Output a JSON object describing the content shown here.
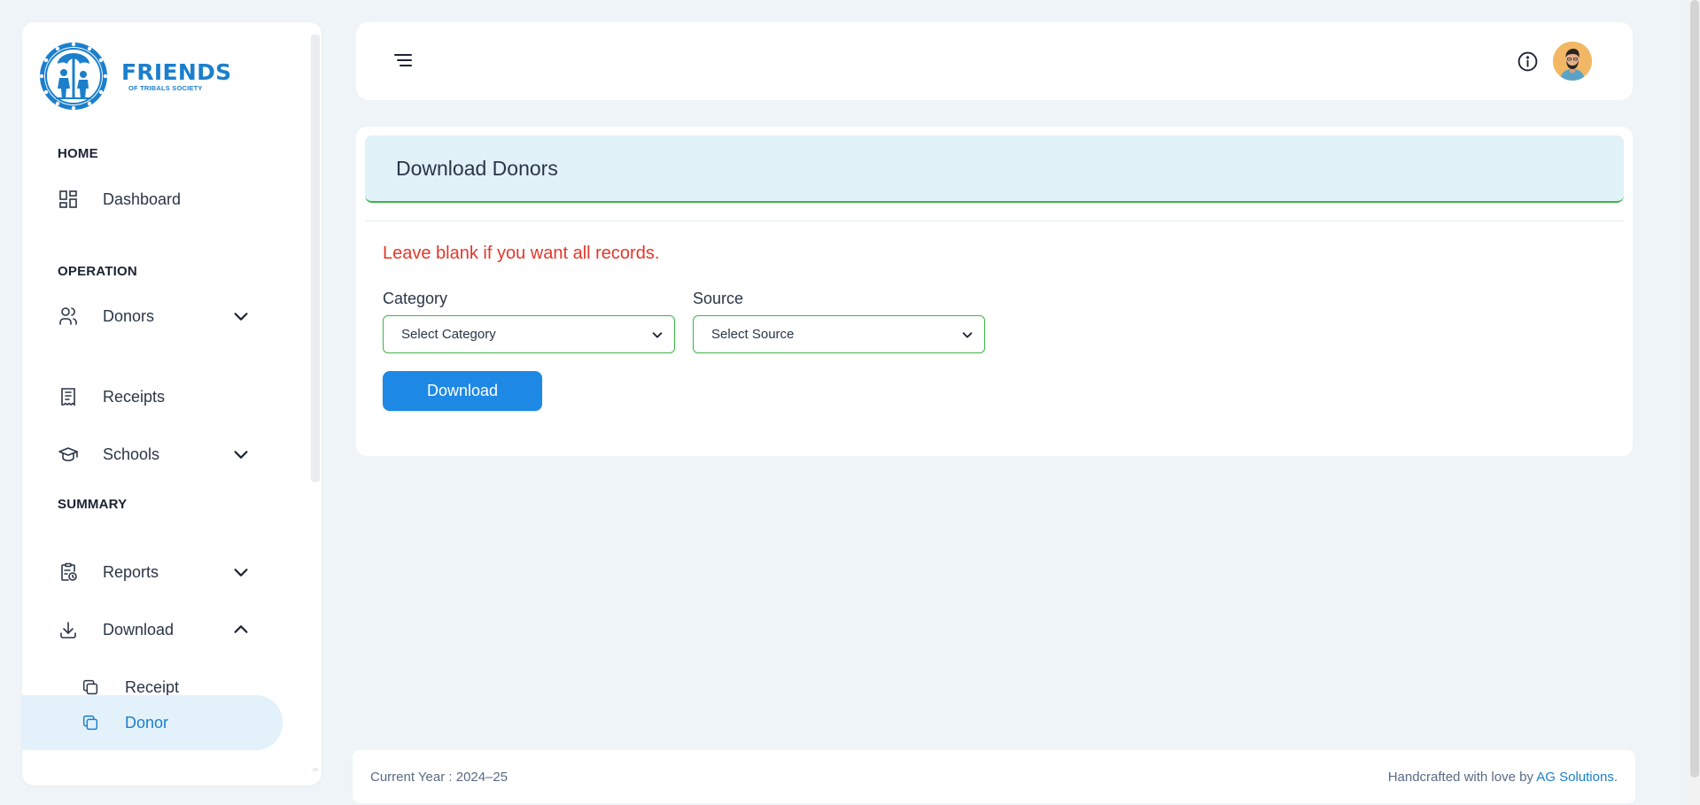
{
  "brand": {
    "name_line1": "FRIENDS",
    "name_line2": "OF TRIBALS SOCIETY",
    "color": "#1b7fcc"
  },
  "sidebar": {
    "sections": [
      {
        "title": "HOME"
      },
      {
        "title": "OPERATION"
      },
      {
        "title": "SUMMARY"
      }
    ],
    "items": [
      {
        "label": "Dashboard",
        "icon": "dashboard-icon"
      },
      {
        "label": "Donors",
        "icon": "users-icon",
        "expandable": true,
        "expanded": false
      },
      {
        "label": "Receipts",
        "icon": "receipt-icon"
      },
      {
        "label": "Schools",
        "icon": "school-icon",
        "expandable": true,
        "expanded": false
      },
      {
        "label": "Reports",
        "icon": "clipboard-icon",
        "expandable": true,
        "expanded": false
      },
      {
        "label": "Download",
        "icon": "download-icon",
        "expandable": true,
        "expanded": true
      },
      {
        "label": "Receipt",
        "icon": "copy-icon"
      },
      {
        "label": "Donor",
        "icon": "copy-icon",
        "active": true
      }
    ]
  },
  "main": {
    "title": "Download Donors",
    "notice": "Leave blank if you want all records.",
    "category": {
      "label": "Category",
      "selected": "Select Category"
    },
    "source": {
      "label": "Source",
      "selected": "Select Source"
    },
    "download_button": "Download"
  },
  "footer": {
    "current_year": "Current Year : 2024–25",
    "credit_prefix": "Handcrafted with love by ",
    "credit_link": "AG Solutions",
    "credit_suffix": "."
  },
  "colors": {
    "accent": "#1e88e5",
    "success_border": "#3cb545",
    "notice": "#e2382b",
    "header_bg": "#e0f2f8"
  }
}
